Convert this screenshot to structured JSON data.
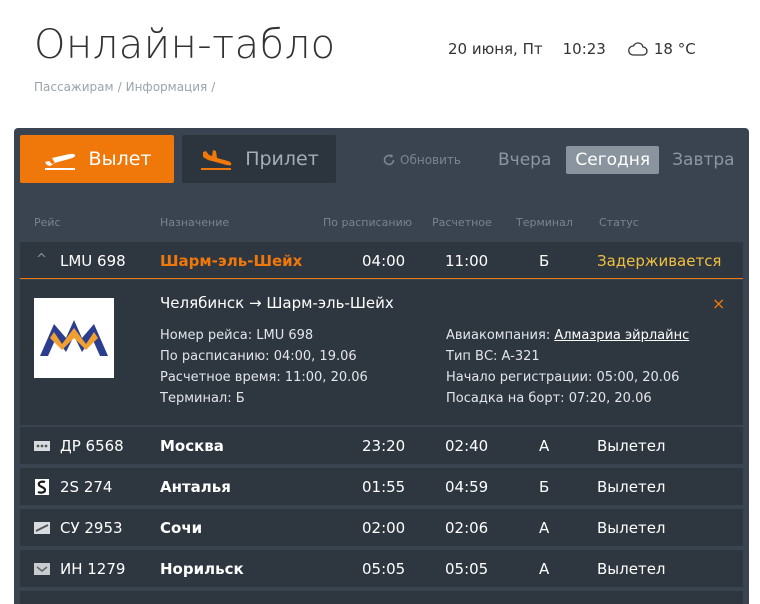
{
  "header": {
    "title": "Онлайн-табло",
    "date": "20 июня, Пт",
    "time": "10:23",
    "temperature": "18 °C",
    "weather_icon": "cloud-icon"
  },
  "breadcrumb": [
    "Пассажирам",
    "Информация"
  ],
  "breadcrumb_sep": "/",
  "tabs": {
    "departure": "Вылет",
    "arrival": "Прилет",
    "refresh": "Обновить",
    "yesterday": "Вчера",
    "today": "Сегодня",
    "tomorrow": "Завтра"
  },
  "columns": {
    "flight": "Рейс",
    "destination": "Назначение",
    "scheduled": "По расписанию",
    "estimated": "Расчетное",
    "terminal": "Терминал",
    "status": "Статус"
  },
  "expanded": {
    "flight": "LMU 698",
    "destination": "Шарм-эль-Шейх",
    "scheduled": "04:00",
    "estimated": "11:00",
    "terminal": "Б",
    "status": "Задерживается",
    "route": "Челябинск → Шарм-эль-Шейх",
    "flight_no_line": "Номер рейса: LMU 698",
    "schedule_line": "По расписанию: 04:00, 19.06",
    "estimated_line": "Расчетное время: 11:00, 20.06",
    "terminal_line": "Терминал: Б",
    "airline_label": "Авиакомпания: ",
    "airline_name": "Алмазриа эйрлайнс",
    "aircraft_line": "Тип ВС: A-321",
    "checkin_line": "Начало регистрации: 05:00, 20.06",
    "boarding_line": "Посадка на борт: 07:20, 20.06",
    "close": "×"
  },
  "flights": [
    {
      "flight": "ДР 6568",
      "destination": "Москва",
      "scheduled": "23:20",
      "estimated": "02:40",
      "terminal": "А",
      "status": "Вылетел",
      "icon": "airline-logo-icon"
    },
    {
      "flight": "2S 274",
      "destination": "Анталья",
      "scheduled": "01:55",
      "estimated": "04:59",
      "terminal": "Б",
      "status": "Вылетел",
      "icon": "airline-logo-icon"
    },
    {
      "flight": "СУ 2953",
      "destination": "Сочи",
      "scheduled": "02:00",
      "estimated": "02:06",
      "terminal": "А",
      "status": "Вылетел",
      "icon": "airline-logo-icon"
    },
    {
      "flight": "ИН 1279",
      "destination": "Норильск",
      "scheduled": "05:05",
      "estimated": "05:05",
      "terminal": "А",
      "status": "Вылетел",
      "icon": "airline-logo-icon"
    }
  ],
  "colors": {
    "accent": "#f0780a",
    "delayed": "#f0c040",
    "board_bg": "#3a4451",
    "row_bg": "#2e3640"
  }
}
